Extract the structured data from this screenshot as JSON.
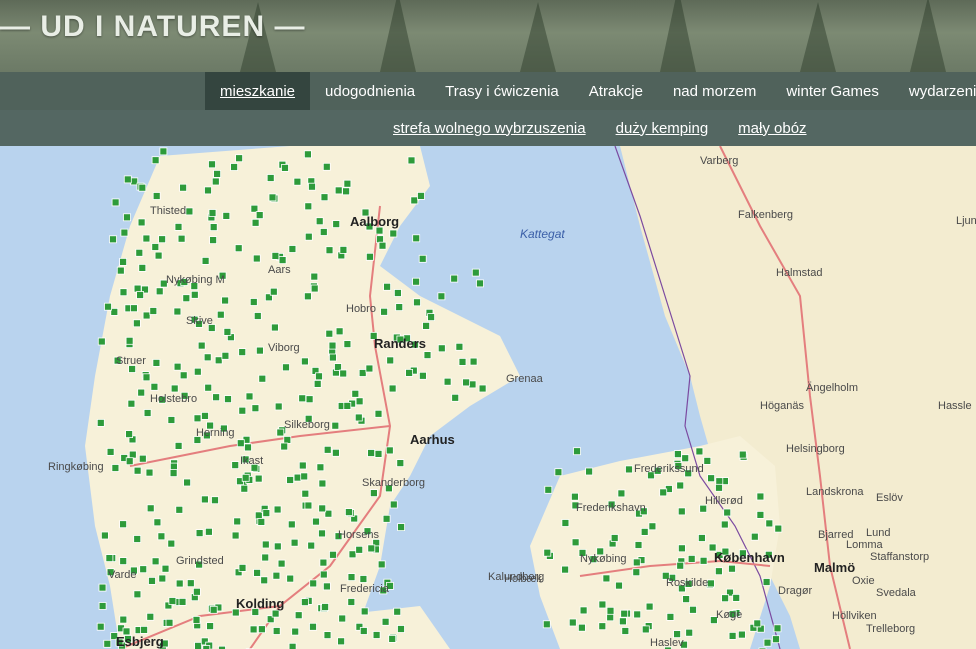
{
  "header": {
    "logo": "— UD I NATUREN —"
  },
  "nav": {
    "items": [
      {
        "label": "mieszkanie",
        "active": true
      },
      {
        "label": "udogodnienia",
        "active": false
      },
      {
        "label": "Trasy i ćwiczenia",
        "active": false
      },
      {
        "label": "Atrakcje",
        "active": false
      },
      {
        "label": "nad morzem",
        "active": false
      },
      {
        "label": "winter Games",
        "active": false
      },
      {
        "label": "wydarzenia",
        "active": false
      }
    ],
    "sub_items": [
      "strefa wolnego wybrzuszenia",
      "duży kemping",
      "mały obóz"
    ]
  },
  "map": {
    "sea_label": "Kattegat",
    "cities": [
      "Aalborg",
      "Randers",
      "Aarhus",
      "Kolding",
      "Esbjerg",
      "København",
      "Malmö"
    ],
    "places": [
      "Varberg",
      "Falkenberg",
      "Halmstad",
      "Ängelholm",
      "Höganäs",
      "Helsingborg",
      "Landskrona",
      "Eslöv",
      "Lund",
      "Staffanstorp",
      "Oxie",
      "Svedala",
      "Trelleborg",
      "Höllviken",
      "Dragør",
      "Køge",
      "Haslev",
      "Roskilde",
      "Hillerød",
      "Frederikssund",
      "Frederikshavn",
      "Nykøbing",
      "Holbæk",
      "Kalundborg",
      "Fredericia",
      "Horsens",
      "Skanderborg",
      "Silkeborg",
      "Viborg",
      "Skive",
      "Struer",
      "Holstebro",
      "Herning",
      "Ikast",
      "Ringkøbing",
      "Grindsted",
      "Varde",
      "Thisted",
      "Nykøbing M",
      "Aars",
      "Hobro",
      "Grenaa",
      "Bjarred",
      "Lomma",
      "Ljun",
      "Hassle"
    ],
    "colors": {
      "sea": "#b9d3ee",
      "land": "#f7f1d9",
      "sweden": "#f3ecd0",
      "road": "#e47e7e",
      "marker": "#2e9b3a",
      "border": "#7b4aa0"
    }
  }
}
